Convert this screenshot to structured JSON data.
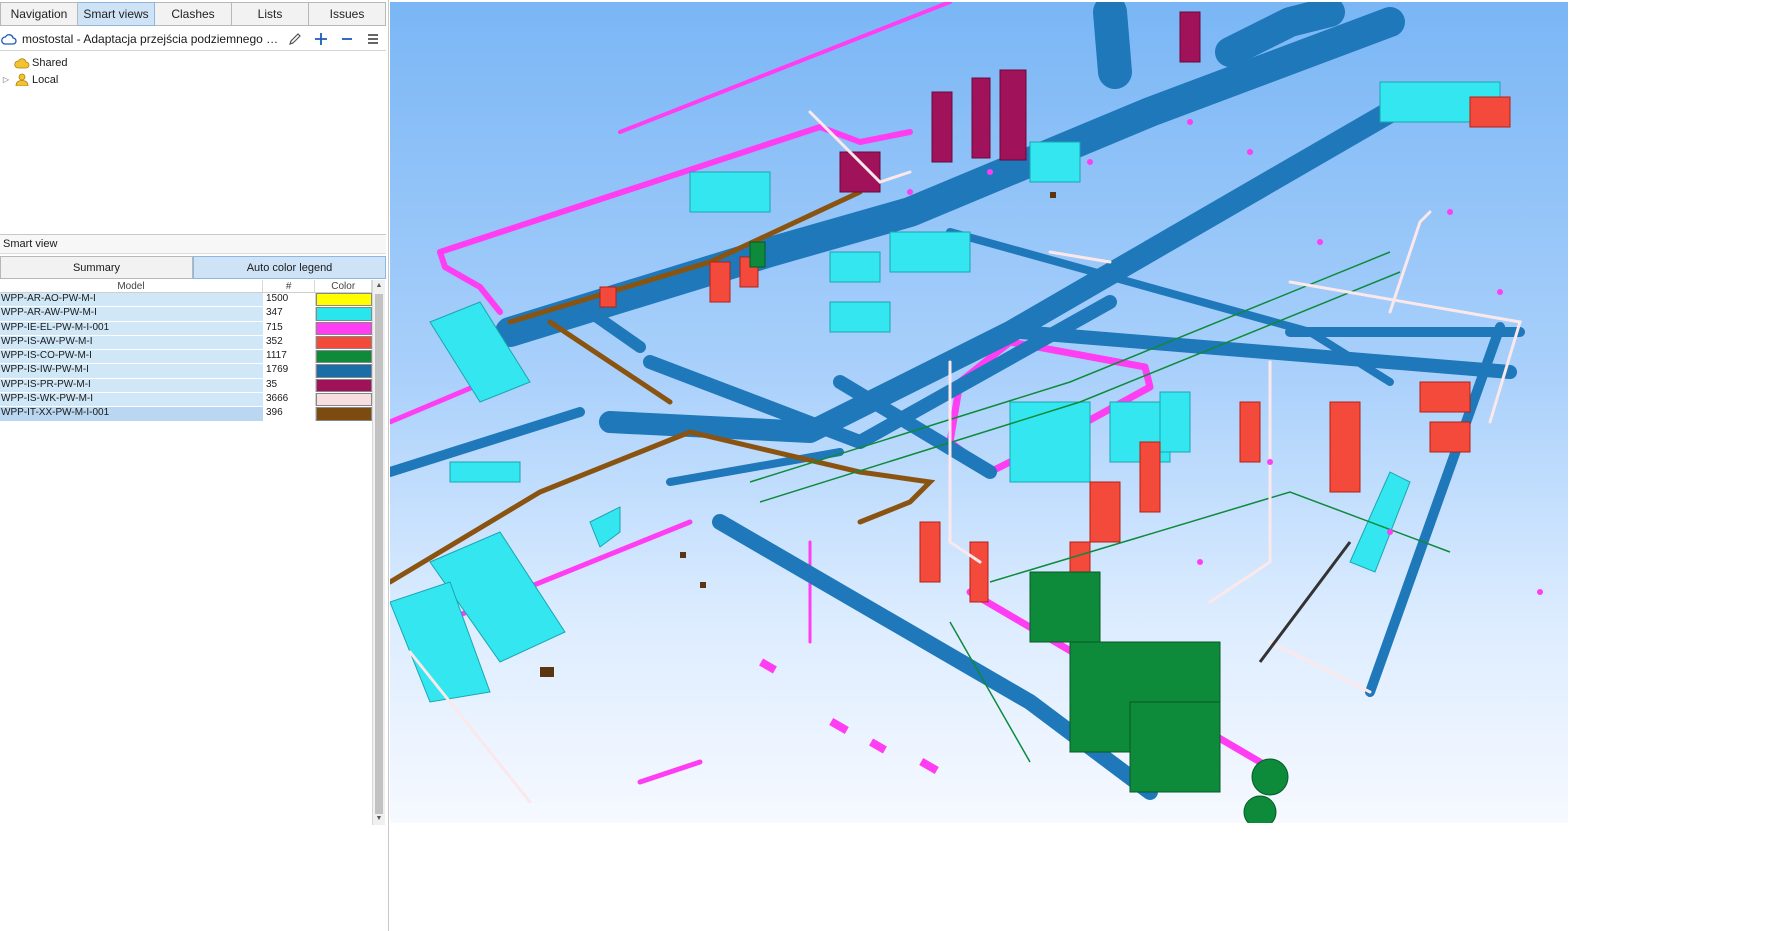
{
  "tabs": [
    {
      "label": "Navigation",
      "active": false
    },
    {
      "label": "Smart views",
      "active": true
    },
    {
      "label": "Clashes",
      "active": false
    },
    {
      "label": "Lists",
      "active": false
    },
    {
      "label": "Issues",
      "active": false
    }
  ],
  "toolbar": {
    "title": "mostostal - Adaptacja przejścia podziemnego pod ulicą..."
  },
  "tree": [
    {
      "label": "Shared",
      "icon": "cloud-folder-icon",
      "expandable": false
    },
    {
      "label": "Local",
      "icon": "user-folder-icon",
      "expandable": true
    }
  ],
  "smart_view": {
    "header": "Smart view",
    "tabs": [
      {
        "label": "Summary",
        "active": false
      },
      {
        "label": "Auto color legend",
        "active": true
      }
    ],
    "columns": {
      "model": "Model",
      "count": "#",
      "color": "Color"
    },
    "rows": [
      {
        "model": "WPP-AR-AO-PW-M-I",
        "count": "1500",
        "color": "#ffff00"
      },
      {
        "model": "WPP-AR-AW-PW-M-I",
        "count": "347",
        "color": "#27e6ee"
      },
      {
        "model": "WPP-IE-EL-PW-M-I-001",
        "count": "715",
        "color": "#ff3df2"
      },
      {
        "model": "WPP-IS-AW-PW-M-I",
        "count": "352",
        "color": "#f44a3c"
      },
      {
        "model": "WPP-IS-CO-PW-M-I",
        "count": "1117",
        "color": "#0d8a3a"
      },
      {
        "model": "WPP-IS-IW-PW-M-I",
        "count": "1769",
        "color": "#1a6ea8"
      },
      {
        "model": "WPP-IS-PR-PW-M-I",
        "count": "35",
        "color": "#a0125a"
      },
      {
        "model": "WPP-IS-WK-PW-M-I",
        "count": "3666",
        "color": "#f8dede"
      },
      {
        "model": "WPP-IT-XX-PW-M-I-001",
        "count": "396",
        "color": "#7d4a10"
      }
    ]
  },
  "colors": {
    "duct_blue": "#1e78b9",
    "cyan": "#33e6ef",
    "magenta": "#ff3df2",
    "red": "#f44a3c",
    "green": "#0d8a3a",
    "brown": "#8a5410",
    "crimson": "#a0125a"
  }
}
